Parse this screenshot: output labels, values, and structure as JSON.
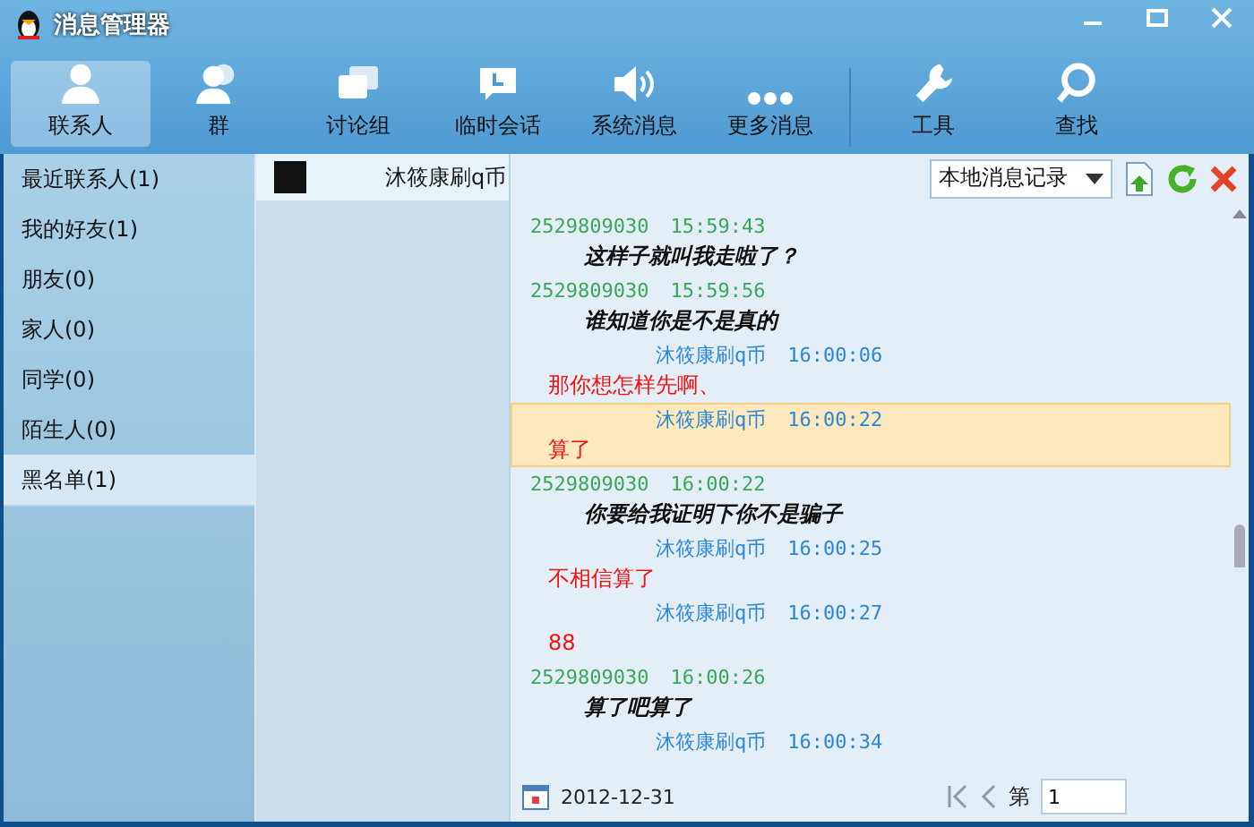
{
  "window": {
    "title": "消息管理器"
  },
  "toolbar": [
    {
      "label": "联系人",
      "kind": "person",
      "selected": true
    },
    {
      "label": "群",
      "kind": "group",
      "selected": false
    },
    {
      "label": "讨论组",
      "kind": "bubbles",
      "selected": false
    },
    {
      "label": "临时会话",
      "kind": "clockbubble",
      "selected": false
    },
    {
      "label": "系统消息",
      "kind": "speaker",
      "selected": false
    },
    {
      "label": "更多消息",
      "kind": "dots",
      "selected": false
    },
    {
      "label": "工具",
      "kind": "wrench",
      "selected": false
    },
    {
      "label": "查找",
      "kind": "search",
      "selected": false
    }
  ],
  "categories": [
    {
      "label": "最近联系人(1)",
      "selected": false
    },
    {
      "label": "我的好友(1)",
      "selected": false
    },
    {
      "label": "朋友(0)",
      "selected": false
    },
    {
      "label": "家人(0)",
      "selected": false
    },
    {
      "label": "同学(0)",
      "selected": false
    },
    {
      "label": "陌生人(0)",
      "selected": false
    },
    {
      "label": "黑名单(1)",
      "selected": true
    }
  ],
  "contacts": [
    {
      "name": "沐筱康刷q币",
      "selected": true
    }
  ],
  "chat": {
    "source": "本地消息记录",
    "messages": [
      {
        "kind": "them",
        "sender": "2529809030",
        "time": "15:59:43",
        "text": "这样子就叫我走啦了？",
        "highlighted": false
      },
      {
        "kind": "them",
        "sender": "2529809030",
        "time": "15:59:56",
        "text": "谁知道你是不是真的",
        "highlighted": false
      },
      {
        "kind": "me",
        "sender": "沐筱康刷q币",
        "time": "16:00:06",
        "text": "那你想怎样先啊、",
        "highlighted": false
      },
      {
        "kind": "me",
        "sender": "沐筱康刷q币",
        "time": "16:00:22",
        "text": "算了",
        "highlighted": true
      },
      {
        "kind": "them",
        "sender": "2529809030",
        "time": "16:00:22",
        "text": "你要给我证明下你不是骗子",
        "highlighted": false
      },
      {
        "kind": "me",
        "sender": "沐筱康刷q币",
        "time": "16:00:25",
        "text": "不相信算了",
        "highlighted": false
      },
      {
        "kind": "me",
        "sender": "沐筱康刷q币",
        "time": "16:00:27",
        "text": "88",
        "highlighted": false
      },
      {
        "kind": "them",
        "sender": "2529809030",
        "time": "16:00:26",
        "text": "算了吧算了",
        "highlighted": false
      },
      {
        "kind": "me",
        "sender": "沐筱康刷q币",
        "time": "16:00:34",
        "highlighted": false
      }
    ]
  },
  "footer": {
    "date": "2012-12-31",
    "page_label": "第",
    "page": "1"
  }
}
